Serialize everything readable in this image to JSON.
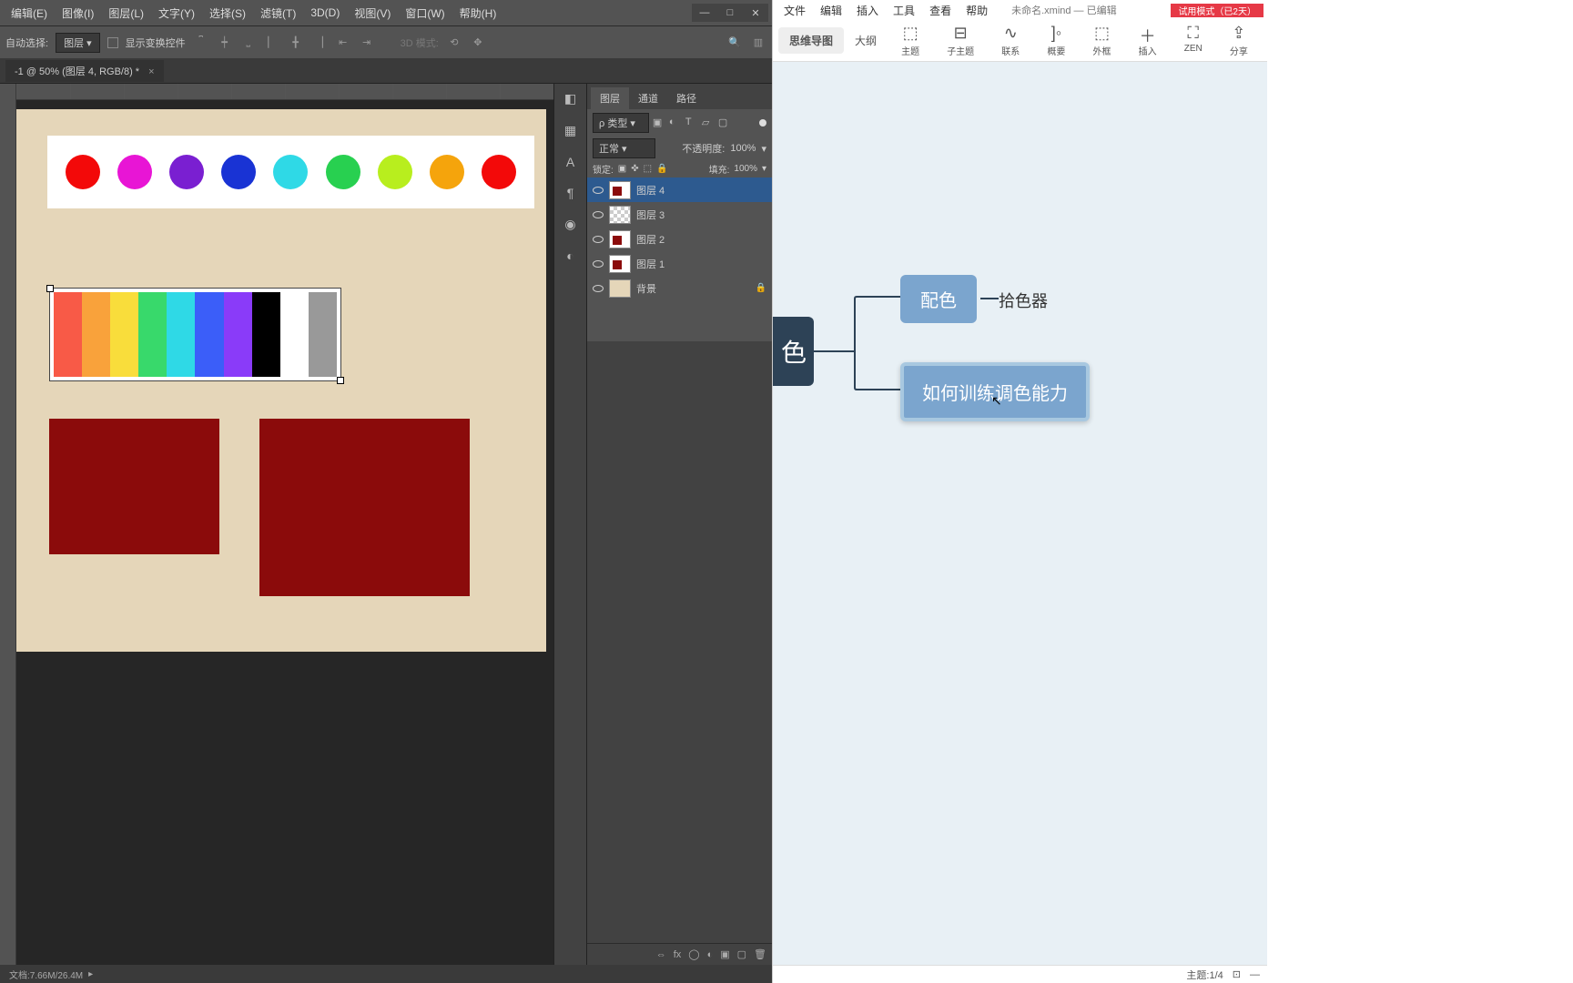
{
  "ps": {
    "menu": [
      "编辑(E)",
      "图像(I)",
      "图层(L)",
      "文字(Y)",
      "选择(S)",
      "滤镜(T)",
      "3D(D)",
      "视图(V)",
      "窗口(W)",
      "帮助(H)"
    ],
    "options": {
      "autoSelect": "自动选择:",
      "target": "图层",
      "showControls": "显示变换控件",
      "mode3d": "3D 模式:"
    },
    "tab": "-1 @ 50% (图层 4, RGB/8) *",
    "panel": {
      "tabs": [
        "图层",
        "通道",
        "路径"
      ],
      "filterLabel": "ρ 类型",
      "blend": "正常",
      "opacityLabel": "不透明度:",
      "opacity": "100%",
      "lockLabel": "锁定:",
      "fillLabel": "填充:",
      "fill": "100%"
    },
    "layers": [
      {
        "name": "图层 4",
        "sel": true
      },
      {
        "name": "图层 3"
      },
      {
        "name": "图层 2"
      },
      {
        "name": "图层 1"
      },
      {
        "name": "背景",
        "locked": true
      }
    ],
    "circles": [
      "#f30909",
      "#e815d5",
      "#7a1fd1",
      "#1933d4",
      "#2fd9e6",
      "#28d050",
      "#b8ee1e",
      "#f5a40c",
      "#f30909"
    ],
    "palette": [
      "#f85a47",
      "#f9a23b",
      "#f9dd3b",
      "#38d96b",
      "#2fd9e6",
      "#3b5ef9",
      "#8a3bf9",
      "#000000",
      "#ffffff",
      "#999999"
    ],
    "status": "文档:7.66M/26.4M"
  },
  "xm": {
    "menu": [
      "文件",
      "编辑",
      "插入",
      "工具",
      "查看",
      "帮助"
    ],
    "title": "未命名.xmind — 已编辑",
    "trial": "试用模式（已2天）",
    "viewTabs": [
      "思维导图",
      "大纲"
    ],
    "tools": [
      {
        "ico": "⬚",
        "lbl": "主题"
      },
      {
        "ico": "⊟",
        "lbl": "子主题"
      },
      {
        "ico": "∿",
        "lbl": "联系"
      },
      {
        "ico": "]◦",
        "lbl": "概要"
      },
      {
        "ico": "⬚",
        "lbl": "外框"
      },
      {
        "ico": "＋",
        "lbl": "插入"
      },
      {
        "ico": "⛶",
        "lbl": "ZEN"
      },
      {
        "ico": "⇪",
        "lbl": "分享"
      }
    ],
    "root": "色",
    "node1": "配色",
    "node2": "如何训练调色能力",
    "leaf": "拾色器",
    "status": "主题:1/4"
  }
}
